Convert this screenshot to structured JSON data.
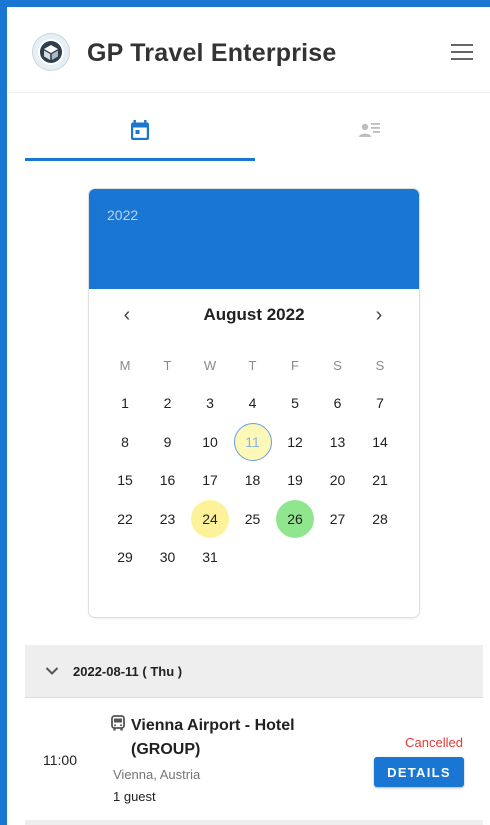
{
  "app": {
    "title": "GP Travel Enterprise"
  },
  "colors": {
    "accent": "#1976d2",
    "highlight_yellow": "#fdf29a",
    "highlight_green": "#8fe68f",
    "cancelled": "#e53935"
  },
  "tabs": [
    {
      "icon": "calendar-icon",
      "active": true
    },
    {
      "icon": "contact-list-icon",
      "active": false
    }
  ],
  "calendar": {
    "year": "2022",
    "month_label": "August 2022",
    "prev": "‹",
    "next": "›",
    "weekdays": [
      "M",
      "T",
      "W",
      "T",
      "F",
      "S",
      "S"
    ],
    "weeks": [
      [
        "1",
        "2",
        "3",
        "4",
        "5",
        "6",
        "7"
      ],
      [
        "8",
        "9",
        "10",
        "11",
        "12",
        "13",
        "14"
      ],
      [
        "15",
        "16",
        "17",
        "18",
        "19",
        "20",
        "21"
      ],
      [
        "22",
        "23",
        "24",
        "25",
        "26",
        "27",
        "28"
      ],
      [
        "29",
        "30",
        "31",
        "",
        "",
        "",
        ""
      ]
    ],
    "selected_day": "11",
    "highlighted_days": {
      "24": "yellow",
      "26": "green"
    }
  },
  "agenda": {
    "date_header": "2022-08-11 ( Thu )",
    "entries": [
      {
        "time": "11:00",
        "title": "Vienna Airport - Hotel (GROUP)",
        "location": "Vienna, Austria",
        "guests": "1 guest",
        "status": "Cancelled",
        "action": "DETAILS"
      }
    ]
  }
}
